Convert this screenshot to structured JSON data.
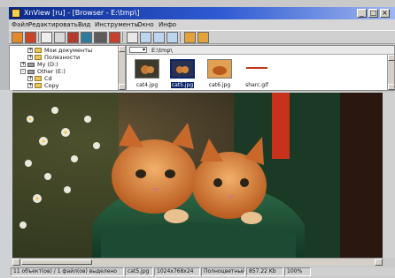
{
  "window": {
    "title": "XnView [ru] - [Browser - E:\\tmp\\]",
    "buttons": [
      "_",
      "□",
      "×"
    ]
  },
  "menu": [
    "Файл",
    "Редактировать",
    "Вид",
    "Инструменты",
    "Окно",
    "Инфо"
  ],
  "toolbar": {
    "icons": [
      "folder-icon",
      "browser-icon",
      "print-icon",
      "scan-icon",
      "capture-icon",
      "settings-icon",
      "slideshow-icon",
      "convert-icon",
      "view-large-icon",
      "view-small-icon",
      "view-list-icon",
      "view-details-icon",
      "help-icon",
      "about-icon"
    ]
  },
  "tree": {
    "items": [
      {
        "label": "Мои документы",
        "type": "folder",
        "expander": "+"
      },
      {
        "label": "Полезности",
        "type": "folder",
        "expander": "+"
      },
      {
        "label": "My (D:)",
        "type": "drive",
        "expander": "+"
      },
      {
        "label": "Other (E:)",
        "type": "drive",
        "expander": "-"
      },
      {
        "label": "Cd",
        "type": "folder",
        "expander": "+"
      },
      {
        "label": "Copy",
        "type": "folder",
        "expander": "+"
      }
    ]
  },
  "browser": {
    "path": "E:\\tmp\\",
    "files": [
      {
        "name": "cat4.jpg",
        "selected": false,
        "color": "#3b3a2c"
      },
      {
        "name": "cat5.jpg",
        "selected": true,
        "color": "#2a3050"
      },
      {
        "name": "cat6.jpg",
        "selected": false,
        "color": "#d77a35"
      },
      {
        "name": "sharc.gif",
        "selected": false,
        "color": "#c0381a"
      }
    ]
  },
  "status": {
    "selection": "11 объект(ов) / 1 файл(ов) выделено",
    "filename": "cat5.jpg",
    "dimensions": "1024x768x24",
    "mode": "Полноцветный",
    "size": "857.22 Kb",
    "zoom": "100%"
  }
}
